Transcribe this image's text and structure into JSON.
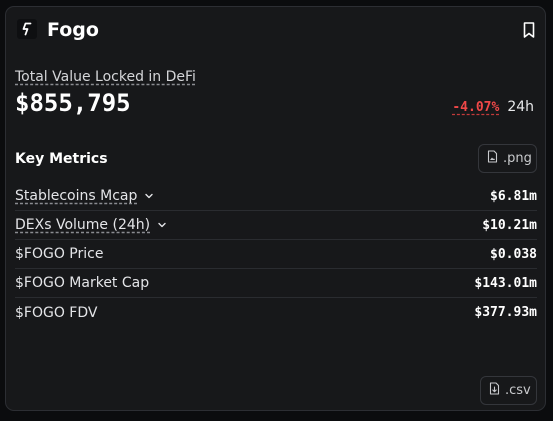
{
  "header": {
    "title": "Fogo",
    "logo_icon": "fogo-logo-icon",
    "bookmark_icon": "bookmark-icon"
  },
  "tvl": {
    "label": "Total Value Locked in DeFi",
    "value": "$855,795",
    "change": "-4.07%",
    "period": "24h",
    "change_color": "#f04848"
  },
  "key_metrics": {
    "title": "Key Metrics",
    "png_label": ".png",
    "csv_label": ".csv",
    "rows": [
      {
        "label": "Stablecoins Mcap",
        "value": "$6.81m",
        "expandable": true
      },
      {
        "label": "DEXs Volume (24h)",
        "value": "$10.21m",
        "expandable": true
      },
      {
        "label": "$FOGO Price",
        "value": "$0.038",
        "expandable": false
      },
      {
        "label": "$FOGO Market Cap",
        "value": "$143.01m",
        "expandable": false
      },
      {
        "label": "$FOGO FDV",
        "value": "$377.93m",
        "expandable": false
      }
    ]
  }
}
